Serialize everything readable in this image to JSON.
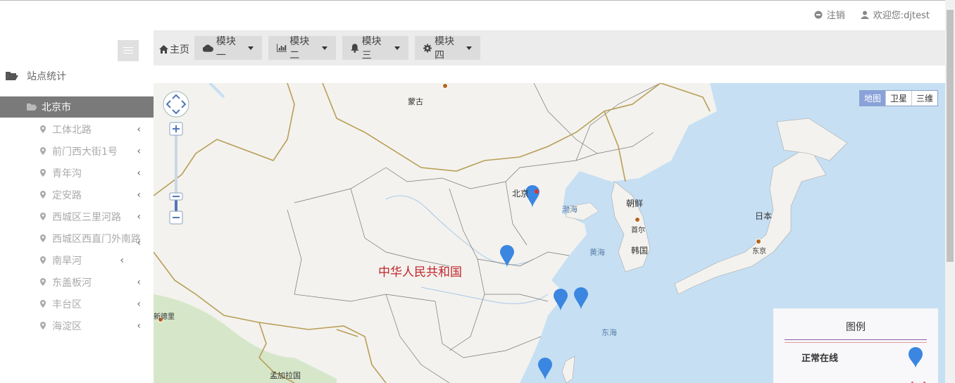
{
  "header": {
    "logout": "注销",
    "welcome": "欢迎您:djtest"
  },
  "sidebar": {
    "title": "站点统计",
    "city": "北京市",
    "districts": [
      {
        "label": "工体北路"
      },
      {
        "label": "前门西大街1号"
      },
      {
        "label": "青年沟"
      },
      {
        "label": "定安路"
      },
      {
        "label": "西城区三里河路"
      },
      {
        "label": "西城区西直门外南路"
      },
      {
        "label": "南旱河"
      },
      {
        "label": "东盖板河"
      },
      {
        "label": "丰台区"
      },
      {
        "label": "海淀区"
      }
    ]
  },
  "nav": {
    "home": "主页",
    "modules": [
      {
        "label": "模块一",
        "icon": "cloud-icon"
      },
      {
        "label": "模块二",
        "icon": "bar-chart-icon"
      },
      {
        "label": "模块三",
        "icon": "bell-icon"
      },
      {
        "label": "模块四",
        "icon": "gear-icon"
      }
    ]
  },
  "map": {
    "types": [
      "地图",
      "卫星",
      "三维"
    ],
    "active_type": "地图",
    "labels": {
      "mongolia": "蒙古",
      "beijing": "北京",
      "bohai": "渤海",
      "korea_n": "朝鲜",
      "seoul": "首尔",
      "korea_s": "韩国",
      "japan": "日本",
      "tokyo": "东京",
      "yellow_sea": "黄海",
      "east_sea": "东海",
      "china": "中华人民共和国",
      "delhi": "新德里",
      "bangladesh": "孟加拉国"
    },
    "legend": {
      "title": "图例",
      "normal": "正常在线"
    },
    "colors": {
      "water": "#c6dff3",
      "land": "#f3f2ee",
      "border": "#b89e57",
      "marker": "#3a86e0"
    }
  }
}
